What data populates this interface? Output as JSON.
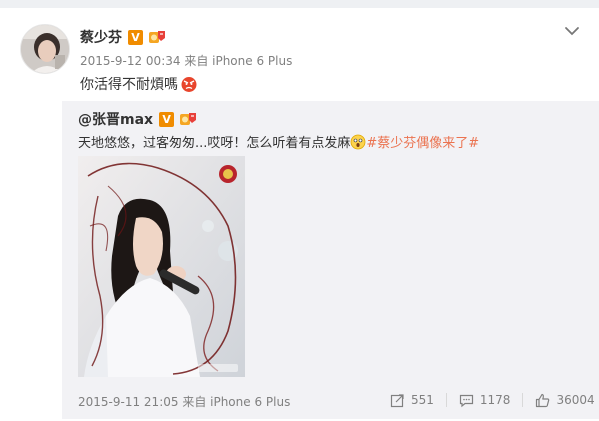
{
  "post": {
    "author": "蔡少芬",
    "verified_badge": "V",
    "meta": "2015-9-12 00:34  来自 iPhone 6 Plus",
    "text": "你活得不耐煩嗎"
  },
  "repost": {
    "author": "@张晋max",
    "verified_badge": "V",
    "text": "天地悠悠，过客匆匆...哎呀！怎么听着有点发麻",
    "hashtag": "#蔡少芬偶像来了#",
    "meta": "2015-9-11 21:05  来自 iPhone 6 Plus",
    "actions": {
      "reposts": "551",
      "comments": "1178",
      "likes": "36004"
    }
  },
  "colors": {
    "accent_orange": "#eb7350",
    "verified": "#f08c00",
    "repost_bg": "#f2f2f5"
  },
  "icons": [
    "chevron-down-icon",
    "medal-icon",
    "angry-face-emoji",
    "surprised-face-emoji",
    "repost-icon",
    "comment-icon",
    "like-icon"
  ]
}
